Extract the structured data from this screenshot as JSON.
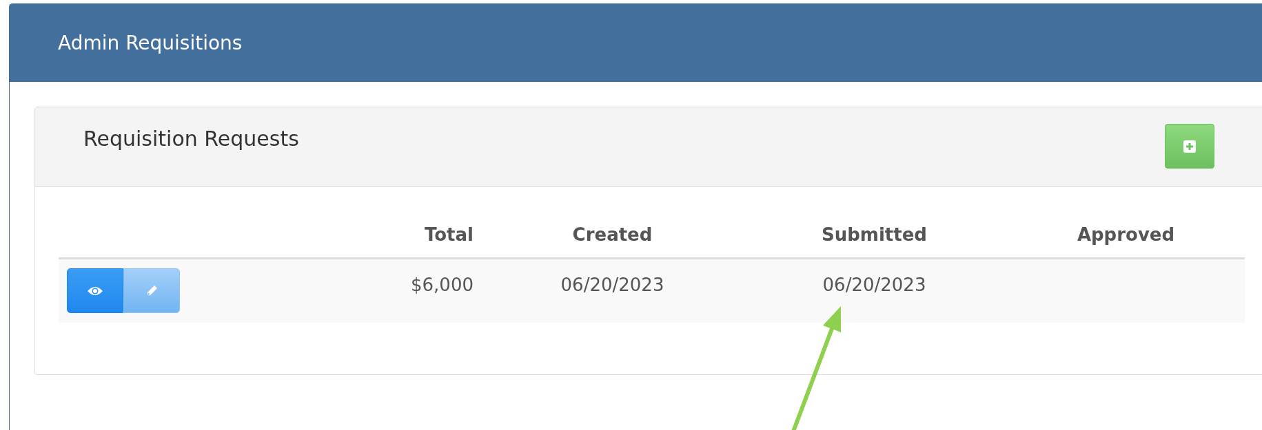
{
  "window": {
    "title": "Admin Requisitions"
  },
  "panel": {
    "title": "Requisition Requests"
  },
  "table": {
    "columns": [
      {
        "kind": "total",
        "label": "Total"
      },
      {
        "kind": "date",
        "label": "Created"
      },
      {
        "kind": "date",
        "label": "Submitted"
      },
      {
        "kind": "date",
        "label": "Approved"
      }
    ],
    "rows": [
      {
        "actions": [
          {
            "kind": "view",
            "disabled": false
          },
          {
            "kind": "edit",
            "disabled": true
          }
        ],
        "cells": [
          "$6,000",
          "06/20/2023",
          "06/20/2023"
        ]
      }
    ]
  },
  "annotation": {
    "kind": "arrow",
    "color": "#8fd14f"
  }
}
